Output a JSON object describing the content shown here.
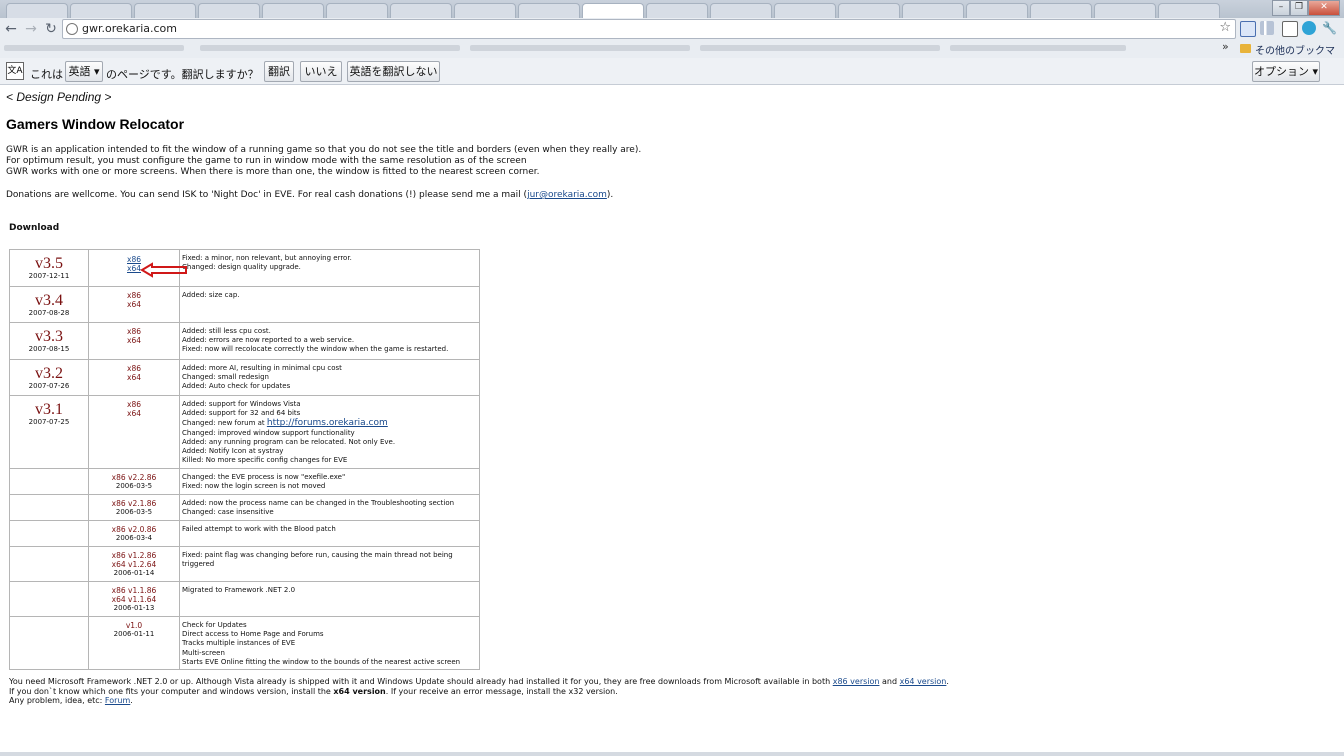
{
  "browser": {
    "url": "gwr.orekaria.com",
    "other_bookmarks": "その他のブックマーク",
    "translate_bar": {
      "prefix": "これは",
      "language": "英語",
      "question": "のページです。翻訳しますか？",
      "translate_button": "翻訳",
      "no_button": "いいえ",
      "never_button": "英語を翻訳しない",
      "options_button": "オプション"
    }
  },
  "page": {
    "design_note": "< Design Pending >",
    "title": "Gamers Window Relocator",
    "intro": [
      "GWR is an application intended to fit the window of a running game so that you do not see the title and borders (even when they really are).",
      "For optimum result, you must configure the game to run in window mode with the same resolution as of the screen",
      "GWR works with one or more screens. When there is more than one, the window is fitted to the nearest screen corner."
    ],
    "donations_prefix": "Donations are wellcome. You can send ISK to 'Night Doc' in EVE. For real cash donations (!) please send me a mail (",
    "donations_email": "jur@orekaria.com",
    "donations_suffix": ").",
    "download_heading": "Download",
    "releases": [
      {
        "version": "v3.5",
        "date": "2007-12-11",
        "downloads": [
          "x86",
          "x64"
        ],
        "linked": true,
        "notes": [
          "Fixed: a minor, non relevant, but annoying error.",
          "Changed: design quality upgrade."
        ]
      },
      {
        "version": "v3.4",
        "date": "2007-08-28",
        "downloads": [
          "x86",
          "x64"
        ],
        "notes": [
          "Added: size cap."
        ]
      },
      {
        "version": "v3.3",
        "date": "2007-08-15",
        "downloads": [
          "x86",
          "x64"
        ],
        "notes": [
          "Added: still less cpu cost.",
          "Added: errors are now reported to a web service.",
          "Fixed: now will recolocate correctly the window when the game is restarted."
        ]
      },
      {
        "version": "v3.2",
        "date": "2007-07-26",
        "downloads": [
          "x86",
          "x64"
        ],
        "notes": [
          "Added: more AI, resulting in minimal cpu cost",
          "Changed: small redesign",
          "Added: Auto check for updates"
        ]
      },
      {
        "version": "v3.1",
        "date": "2007-07-25",
        "downloads": [
          "x86",
          "x64"
        ],
        "notes": [
          "Added: support for Windows Vista",
          "Added: support for 32 and 64 bits"
        ],
        "forum_prefix": "Changed: new forum at ",
        "forum_link": "http://forums.orekaria.com",
        "notes_after": [
          "Changed: improved window support functionality",
          "Added: any running program can be relocated. Not only Eve.",
          "Added: Notify Icon at systray",
          "Killed: No more specific config changes for EVE"
        ]
      },
      {
        "downloads": [
          "x86 v2.2.86"
        ],
        "date": "2006-03-5",
        "notes": [
          "Changed: the EVE process is now \"exefile.exe\"",
          "Fixed: now the login screen is not moved"
        ]
      },
      {
        "downloads": [
          "x86 v2.1.86"
        ],
        "date": "2006-03-5",
        "notes": [
          "Added: now the process name can be changed in the Troubleshooting section",
          "Changed: case insensitive"
        ]
      },
      {
        "downloads": [
          "x86 v2.0.86"
        ],
        "date": "2006-03-4",
        "notes": [
          "Failed attempt to work with the Blood patch"
        ]
      },
      {
        "downloads": [
          "x86 v1.2.86",
          "x64 v1.2.64"
        ],
        "date": "2006-01-14",
        "notes": [
          "Fixed: paint flag was changing before run, causing the main thread not being triggered"
        ]
      },
      {
        "downloads": [
          "x86 v1.1.86",
          "x64 v1.1.64"
        ],
        "date": "2006-01-13",
        "notes": [
          "Migrated to Framework .NET 2.0"
        ]
      },
      {
        "downloads": [
          "v1.0"
        ],
        "date": "2006-01-11",
        "notes": [
          "Check for Updates",
          "Direct access to Home Page and Forums",
          "Tracks multiple instances of EVE",
          "Multi-screen",
          "Starts EVE Online fitting the window to the bounds of the nearest active screen"
        ]
      }
    ],
    "footer": {
      "line1_prefix": "You need Microsoft Framework .NET 2.0 or up. Although Vista already is shipped with it and Windows Update should already had installed it for you, they are free downloads from Microsoft available in both ",
      "x86_link": "x86 version",
      "and": " and ",
      "x64_link": "x64 version",
      "line1_suffix": ".",
      "line2_prefix": "If you don`t know which one fits your computer and windows version, install the ",
      "line2_bold": "x64 version",
      "line2_suffix": ". If your receive an error message, install the x32 version.",
      "line3_prefix": "Any problem, idea, etc: ",
      "forum_link": "Forum",
      "line3_suffix": "."
    }
  },
  "colors": {
    "version_red": "#7a1111",
    "link_blue": "#1a4a8c",
    "arrow_red": "#d01818"
  }
}
